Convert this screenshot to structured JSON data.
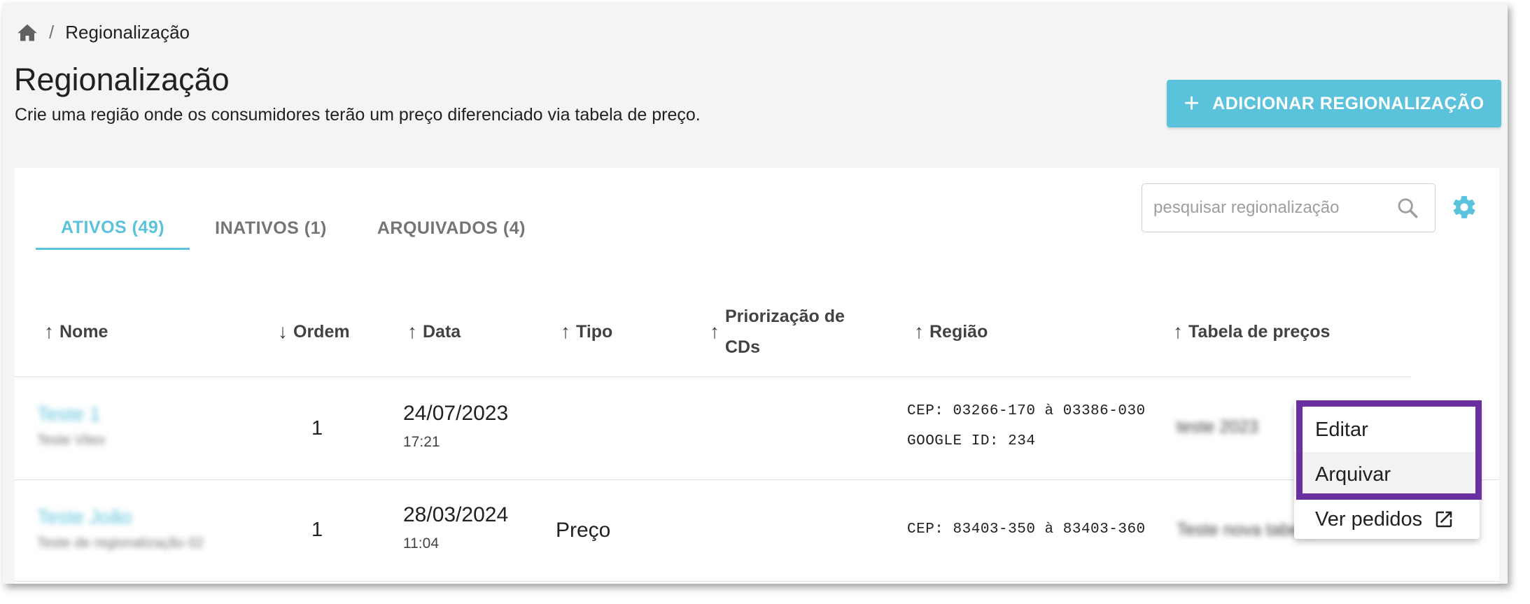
{
  "breadcrumb": {
    "separator": "/",
    "current": "Regionalização",
    "home_icon": "home-icon"
  },
  "header": {
    "title": "Regionalização",
    "subtitle": "Crie uma região onde os consumidores terão um preço diferenciado via tabela de preço.",
    "add_button": {
      "icon": "+",
      "label": "ADICIONAR REGIONALIZAÇÃO"
    }
  },
  "colors": {
    "accent": "#5bc2dc",
    "highlight": "#6a2fa0",
    "background": "#f4f4f4"
  },
  "tabs": [
    {
      "label": "ATIVOS (49)",
      "active": true
    },
    {
      "label": "INATIVOS (1)",
      "active": false
    },
    {
      "label": "ARQUIVADOS (4)",
      "active": false
    }
  ],
  "search": {
    "placeholder": "pesquisar regionalização",
    "icon": "search-icon"
  },
  "settings_icon": "gear-icon",
  "table": {
    "columns": [
      {
        "label": "Nome",
        "sort": "↑"
      },
      {
        "label": "Ordem",
        "sort": "↓"
      },
      {
        "label": "Data",
        "sort": "↑"
      },
      {
        "label": "Tipo",
        "sort": "↑"
      },
      {
        "label_line1": "Priorização de",
        "label_line2": "CDs",
        "sort": "↑"
      },
      {
        "label": "Região",
        "sort": "↑"
      },
      {
        "label": "Tabela de preços",
        "sort": "↑"
      }
    ],
    "rows": [
      {
        "name": "Teste 1",
        "description": "Teste Vitex",
        "order": "1",
        "date": "24/07/2023",
        "time": "17:21",
        "type": "",
        "region_line1": "CEP: 03266-170 à 03386-030",
        "region_line2": "GOOGLE ID: 234",
        "price_table": "teste 2023"
      },
      {
        "name": "Teste João",
        "description": "Teste de regionalização 02",
        "order": "1",
        "date": "28/03/2024",
        "time": "11:04",
        "type": "Preço",
        "region_line1": "CEP: 83403-350 à 83403-360",
        "region_line2": "",
        "price_table": "Teste nova tabela"
      }
    ]
  },
  "context_menu": {
    "items": [
      {
        "label": "Editar"
      },
      {
        "label": "Arquivar"
      },
      {
        "label": "Ver pedidos",
        "icon": "external-link-icon"
      }
    ]
  }
}
